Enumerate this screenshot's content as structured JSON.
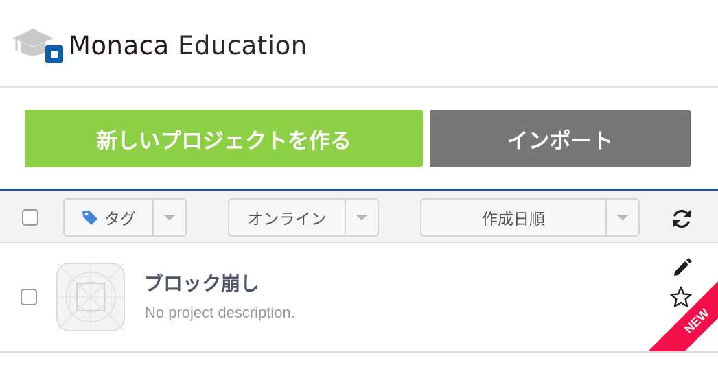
{
  "header": {
    "brand": "Monaca",
    "product": "Education",
    "logo_icon": "graduation-cap-icon"
  },
  "actions": {
    "create_project_label": "新しいプロジェクトを作る",
    "import_label": "インポート"
  },
  "toolbar": {
    "tag_filter_label": "タグ",
    "online_filter_label": "オンライン",
    "sort_label": "作成日順",
    "refresh_icon": "refresh-icon"
  },
  "projects": [
    {
      "title": "ブロック崩し",
      "description": "No project description.",
      "badge": "NEW"
    }
  ],
  "colors": {
    "primary_button": "#8dcf45",
    "import_button": "#777777",
    "accent_rule": "#1f56a3",
    "new_badge": "#f20f4a",
    "brand_blue": "#0b5ea8"
  }
}
